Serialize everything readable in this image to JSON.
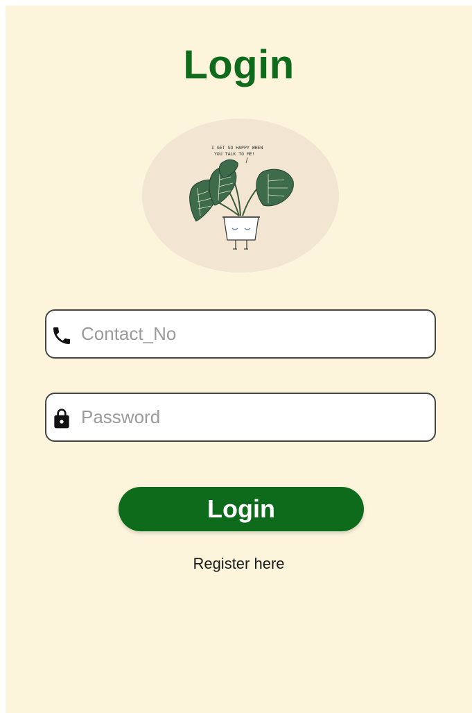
{
  "screen": {
    "title": "Login",
    "background_color": "#fcf5dc",
    "accent_color": "#0f6b1c"
  },
  "illustration": {
    "speech_line_1": "I GET SO HAPPY WHEN",
    "speech_line_2": "YOU TALK TO ME!",
    "subject": "potted-plant"
  },
  "form": {
    "contact": {
      "icon": "phone-icon",
      "placeholder": "Contact_No",
      "value": ""
    },
    "password": {
      "icon": "lock-icon",
      "placeholder": "Password",
      "value": ""
    },
    "login_label": "Login",
    "register_label": "Register here"
  }
}
